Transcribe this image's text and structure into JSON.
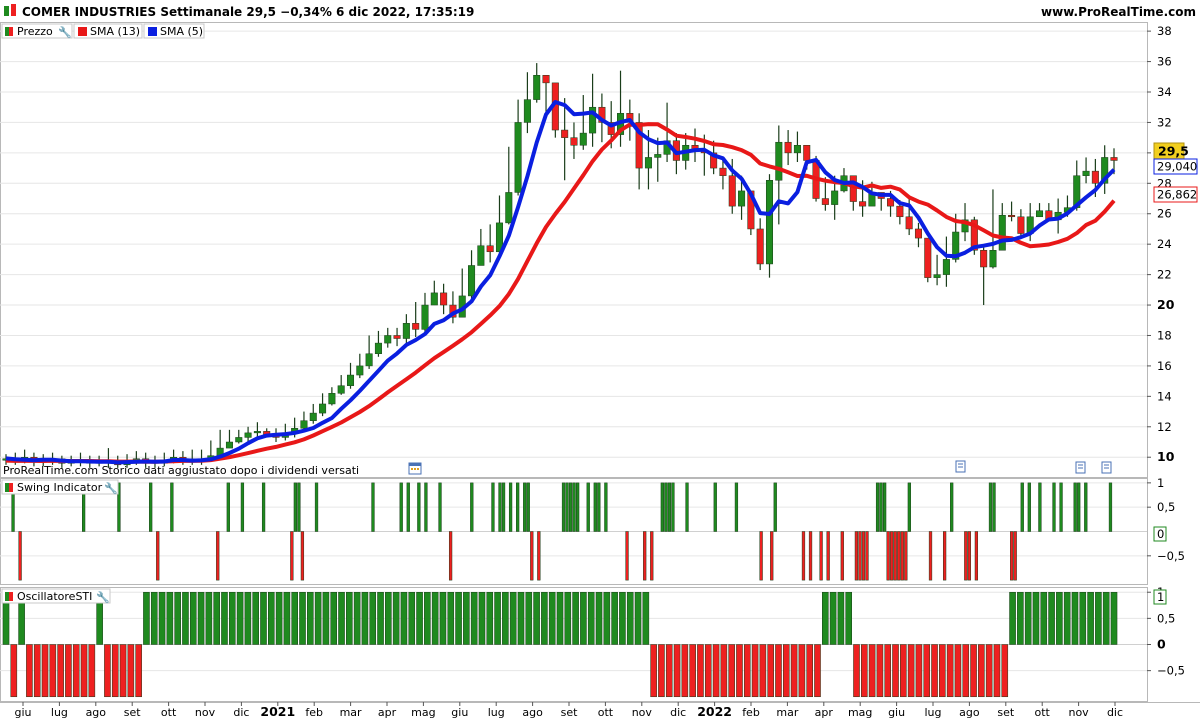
{
  "header": {
    "title": "COMER INDUSTRIES Settimanale 29,5 −0,34% 6 dic 2022, 17:35:19",
    "site": "www.ProRealTime.com"
  },
  "legend": {
    "price_label": "Prezzo",
    "sma13_label": "SMA (13)",
    "sma5_label": "SMA (5)"
  },
  "footer_note": "ProRealTime.com  Storico dati aggiustato dopo i dividendi versati",
  "badges": {
    "last_price": "29,5",
    "sma5_value": "29,040",
    "sma13_value": "26,862",
    "swing_last": "0",
    "sti_last": "1"
  },
  "panels": {
    "swing_title": "Swing Indicator",
    "sti_title": "OscillatoreSTI"
  },
  "colors": {
    "up": "#1f8a1f",
    "down": "#ee2020",
    "sma5": "#0a1fe0",
    "sma13": "#e81818",
    "grid": "#e6e6e6",
    "last_badge": "#f2cf1f"
  },
  "chart_data": [
    {
      "type": "candlestick",
      "title": "COMER INDUSTRIES Settimanale",
      "x_ticks": [
        "giu",
        "lug",
        "ago",
        "set",
        "ott",
        "nov",
        "dic",
        "2021",
        "feb",
        "mar",
        "apr",
        "mag",
        "giu",
        "lug",
        "ago",
        "set",
        "ott",
        "nov",
        "dic",
        "2022",
        "feb",
        "mar",
        "apr",
        "mag",
        "giu",
        "lug",
        "ago",
        "set",
        "ott",
        "nov",
        "dic"
      ],
      "y_ticks": [
        10,
        12,
        14,
        16,
        18,
        20,
        22,
        24,
        26,
        28,
        30,
        32,
        34,
        36,
        38
      ],
      "ylim": [
        8.7,
        38.6
      ],
      "close": [
        9.9,
        9.8,
        10.0,
        9.7,
        9.8,
        9.9,
        9.6,
        9.7,
        9.8,
        9.6,
        9.7,
        9.7,
        9.5,
        9.7,
        9.9,
        9.8,
        9.6,
        9.8,
        10.0,
        9.9,
        9.7,
        9.9,
        10.1,
        10.6,
        11.0,
        11.3,
        11.6,
        11.7,
        11.5,
        11.3,
        11.6,
        11.9,
        12.4,
        12.9,
        13.5,
        14.2,
        14.7,
        15.4,
        16.0,
        16.8,
        17.5,
        18.0,
        17.8,
        18.8,
        18.4,
        20.0,
        20.8,
        20.0,
        19.2,
        20.6,
        22.6,
        23.9,
        23.5,
        25.4,
        27.4,
        32.0,
        33.5,
        35.1,
        34.6,
        31.5,
        31.0,
        30.5,
        31.3,
        33.0,
        32.0,
        31.2,
        32.6,
        32.0,
        29.0,
        29.7,
        29.9,
        30.8,
        29.5,
        30.5,
        30.2,
        30.0,
        29.0,
        28.5,
        26.5,
        27.5,
        25.0,
        22.7,
        28.2,
        30.7,
        30.0,
        30.5,
        29.5,
        27.0,
        26.6,
        27.5,
        28.5,
        26.8,
        26.5,
        27.4,
        27.0,
        26.5,
        25.8,
        25.0,
        24.4,
        21.8,
        22.0,
        23.0,
        24.8,
        25.6,
        23.6,
        22.5,
        23.6,
        25.9,
        25.8,
        24.7,
        25.8,
        26.2,
        25.6,
        26.1,
        26.4,
        28.5,
        28.8,
        28.0,
        29.7,
        29.5
      ],
      "high": [
        10.2,
        10.3,
        10.5,
        10.3,
        10.2,
        10.3,
        10.1,
        10.1,
        10.3,
        10.1,
        10.1,
        10.6,
        10.1,
        10.2,
        10.4,
        10.3,
        10.1,
        10.3,
        10.5,
        10.4,
        10.5,
        10.5,
        11.1,
        11.8,
        11.8,
        11.8,
        12.0,
        12.3,
        11.9,
        11.9,
        12.2,
        12.6,
        13.0,
        13.5,
        14.2,
        14.6,
        15.4,
        16.2,
        16.8,
        18.0,
        18.3,
        18.5,
        18.5,
        19.4,
        20.2,
        20.8,
        21.6,
        21.4,
        20.9,
        22.4,
        23.6,
        25.0,
        25.3,
        27.2,
        30.4,
        33.5,
        35.3,
        35.9,
        34.6,
        34.0,
        33.6,
        32.0,
        33.8,
        35.2,
        33.9,
        33.4,
        35.4,
        33.5,
        32.6,
        31.5,
        31.0,
        33.3,
        31.3,
        31.3,
        31.6,
        31.2,
        30.8,
        29.5,
        29.6,
        28.5,
        27.5,
        25.7,
        28.6,
        31.8,
        31.5,
        31.4,
        30.4,
        29.8,
        28.4,
        28.5,
        29.0,
        28.1,
        28.2,
        28.1,
        27.4,
        27.5,
        26.9,
        27.2,
        25.4,
        23.8,
        23.3,
        24.5,
        26.0,
        26.7,
        25.8,
        23.9,
        27.6,
        26.7,
        26.8,
        26.3,
        26.7,
        26.7,
        26.7,
        27.0,
        27.2,
        29.5,
        29.7,
        29.6,
        30.5,
        30.3
      ],
      "low": [
        9.5,
        9.5,
        9.6,
        9.4,
        9.4,
        9.5,
        9.3,
        9.4,
        9.4,
        9.3,
        9.4,
        9.3,
        9.3,
        9.3,
        9.5,
        9.3,
        9.3,
        9.4,
        9.6,
        9.5,
        9.5,
        9.5,
        9.7,
        10.0,
        10.6,
        10.9,
        10.9,
        11.2,
        11.3,
        11.0,
        11.1,
        11.3,
        11.8,
        12.2,
        12.7,
        13.4,
        14.1,
        14.5,
        15.2,
        15.8,
        16.6,
        17.2,
        17.3,
        17.5,
        17.9,
        18.2,
        20.0,
        19.4,
        18.8,
        19.2,
        20.4,
        22.6,
        22.8,
        23.4,
        25.3,
        27.2,
        31.3,
        33.3,
        32.5,
        31.0,
        28.2,
        29.6,
        30.2,
        30.4,
        30.7,
        30.3,
        30.4,
        30.8,
        27.6,
        27.6,
        28.1,
        29.4,
        28.6,
        28.9,
        29.4,
        28.5,
        28.6,
        27.6,
        26.0,
        25.6,
        24.6,
        22.3,
        21.8,
        25.3,
        29.2,
        29.4,
        28.9,
        26.8,
        26.2,
        25.6,
        27.4,
        26.2,
        25.8,
        26.6,
        26.2,
        25.8,
        25.3,
        24.6,
        23.8,
        21.5,
        21.3,
        21.2,
        22.8,
        24.2,
        23.3,
        20.0,
        22.4,
        24.5,
        25.5,
        24.4,
        24.2,
        25.8,
        25.5,
        24.7,
        25.8,
        26.2,
        28.0,
        27.1,
        27.3,
        28.6
      ],
      "sma5": [
        9.92,
        9.86,
        9.84,
        9.8,
        9.84,
        9.84,
        9.78,
        9.74,
        9.74,
        9.72,
        9.7,
        9.7,
        9.66,
        9.68,
        9.7,
        9.72,
        9.7,
        9.72,
        9.82,
        9.82,
        9.78,
        9.8,
        9.86,
        10.04,
        10.28,
        10.56,
        10.92,
        11.24,
        11.42,
        11.48,
        11.52,
        11.6,
        11.74,
        11.92,
        12.26,
        12.58,
        13.18,
        13.74,
        14.36,
        15.02,
        15.68,
        16.34,
        16.82,
        17.38,
        17.7,
        18.1,
        18.76,
        19.0,
        19.44,
        19.72,
        20.24,
        21.22,
        21.96,
        23.2,
        24.56,
        26.44,
        28.46,
        30.68,
        32.52,
        33.34,
        33.14,
        32.54,
        32.58,
        32.66,
        32.16,
        31.8,
        32.02,
        32.16,
        31.36,
        30.9,
        30.64,
        30.68,
        29.98,
        30.08,
        30.18,
        30.2,
        29.84,
        29.64,
        28.84,
        28.3,
        27.3,
        26.04,
        25.98,
        26.82,
        26.68,
        27.42,
        29.38,
        29.54,
        28.72,
        28.22,
        28.02,
        28.06,
        27.76,
        27.34,
        27.24,
        27.24,
        26.7,
        26.54,
        25.74,
        24.7,
        23.8,
        23.24,
        23.2,
        23.44,
        23.8,
        23.9,
        24.02,
        24.24,
        24.28,
        24.46,
        24.7,
        25.22,
        25.62,
        25.68,
        26.02,
        26.56,
        27.08,
        27.56,
        28.28,
        28.9
      ],
      "sma13": [
        9.78,
        9.76,
        9.77,
        9.76,
        9.75,
        9.77,
        9.76,
        9.75,
        9.75,
        9.75,
        9.74,
        9.74,
        9.71,
        9.71,
        9.72,
        9.7,
        9.7,
        9.72,
        9.74,
        9.76,
        9.76,
        9.77,
        9.81,
        9.9,
        10.0,
        10.13,
        10.27,
        10.42,
        10.56,
        10.68,
        10.83,
        10.98,
        11.17,
        11.43,
        11.71,
        11.99,
        12.28,
        12.62,
        12.97,
        13.36,
        13.8,
        14.26,
        14.69,
        15.13,
        15.56,
        16.04,
        16.51,
        16.91,
        17.32,
        17.75,
        18.21,
        18.76,
        19.32,
        19.93,
        20.72,
        21.72,
        22.89,
        24.06,
        25.13,
        25.98,
        26.78,
        27.66,
        28.53,
        29.45,
        30.22,
        30.81,
        31.48,
        31.86,
        31.83,
        31.89,
        31.88,
        31.53,
        31.13,
        31.04,
        30.93,
        30.78,
        30.57,
        30.52,
        30.37,
        30.18,
        29.87,
        29.3,
        29.11,
        28.95,
        28.72,
        28.48,
        28.49,
        28.31,
        28.17,
        28.07,
        28.02,
        27.8,
        27.71,
        27.86,
        27.7,
        27.78,
        27.59,
        27.08,
        26.8,
        26.6,
        26.21,
        25.79,
        25.52,
        25.44,
        25.25,
        24.92,
        24.57,
        24.44,
        24.39,
        24.09,
        23.86,
        23.91,
        23.98,
        24.14,
        24.35,
        24.73,
        25.26,
        25.54,
        26.14,
        26.86
      ],
      "series": [
        {
          "name": "Prezzo"
        },
        {
          "name": "SMA (13)"
        },
        {
          "name": "SMA (5)"
        }
      ]
    },
    {
      "type": "bar",
      "title": "Swing Indicator",
      "y_ticks": [
        1,
        0.5,
        -0.5
      ],
      "ylim": [
        -1.1,
        1.1
      ],
      "values": [
        0,
        0,
        1,
        0,
        -1,
        0,
        0,
        0,
        0,
        0,
        0,
        0,
        0,
        0,
        0,
        0,
        0,
        0,
        0,
        0,
        0,
        0,
        1,
        0,
        0,
        0,
        0,
        0,
        0,
        0,
        0,
        0,
        1,
        0,
        0,
        0,
        0,
        0,
        0,
        0,
        0,
        1,
        0,
        -1,
        0,
        0,
        0,
        1,
        0,
        0,
        0,
        0,
        0,
        0,
        0,
        0,
        0,
        0,
        0,
        0,
        -1,
        0,
        0,
        1,
        0,
        0,
        0,
        1,
        0,
        0,
        0,
        0,
        0,
        1,
        0,
        0,
        0,
        0,
        0,
        0,
        0,
        -1,
        1,
        1,
        -1,
        0,
        0,
        0,
        1,
        0,
        0,
        0,
        0,
        0,
        0,
        0,
        0,
        0,
        0,
        0,
        0,
        0,
        0,
        0,
        1,
        0,
        0,
        0,
        0,
        0,
        0,
        0,
        1,
        0,
        1,
        0,
        0,
        1,
        0,
        1,
        0,
        0,
        0,
        1,
        0,
        0,
        -1,
        0,
        0,
        0,
        0,
        0,
        1,
        0,
        0,
        0,
        0,
        0,
        1,
        0,
        1,
        1,
        0,
        1,
        0,
        1,
        0,
        1,
        1,
        -1,
        0,
        -1,
        0,
        0,
        0,
        0,
        0,
        0,
        1,
        1,
        1,
        1,
        1,
        0,
        0,
        1,
        0,
        1,
        1,
        0,
        1,
        0,
        0,
        0,
        0,
        0,
        -1,
        0,
        0,
        0,
        0,
        -1,
        0,
        -1,
        0,
        0,
        1,
        1,
        1,
        1,
        0,
        0,
        0,
        1,
        0,
        0,
        0,
        0,
        0,
        0,
        0,
        1,
        0,
        0,
        0,
        0,
        0,
        1,
        0,
        0,
        0,
        0,
        0,
        0,
        -1,
        0,
        0,
        -1,
        1,
        0,
        0,
        0,
        0,
        0,
        0,
        0,
        -1,
        0,
        -1,
        0,
        0,
        -1,
        0,
        -1,
        0,
        0,
        0,
        -1,
        0,
        0,
        0,
        -1,
        -1,
        -1,
        -1,
        0,
        0,
        1,
        1,
        1,
        -1,
        -1,
        -1,
        -1,
        -1,
        -1,
        1,
        0,
        0,
        0,
        0,
        0,
        -1,
        0,
        0,
        0,
        -1,
        0,
        1,
        0,
        0,
        0,
        -1,
        -1,
        0,
        -1,
        0,
        0,
        0,
        1,
        1,
        0,
        0,
        0,
        0,
        -1,
        -1,
        0,
        1,
        0,
        1,
        0,
        0,
        1,
        0,
        0,
        0,
        1,
        0,
        1,
        0,
        0,
        0,
        1,
        1,
        0,
        1,
        0,
        0,
        0,
        0,
        0,
        0,
        1,
        0
      ]
    },
    {
      "type": "bar",
      "title": "OscillatoreSTI",
      "y_ticks": [
        1,
        0.5,
        0,
        -0.5
      ],
      "ylim": [
        -1.1,
        1.1
      ],
      "values": [
        1,
        -1,
        1,
        -1,
        -1,
        -1,
        -1,
        -1,
        -1,
        -1,
        -1,
        -1,
        1,
        -1,
        -1,
        -1,
        -1,
        -1,
        1,
        1,
        1,
        1,
        1,
        1,
        1,
        1,
        1,
        1,
        1,
        1,
        1,
        1,
        1,
        1,
        1,
        1,
        1,
        1,
        1,
        1,
        1,
        1,
        1,
        1,
        1,
        1,
        1,
        1,
        1,
        1,
        1,
        1,
        1,
        1,
        1,
        1,
        1,
        1,
        1,
        1,
        1,
        1,
        1,
        1,
        1,
        1,
        1,
        1,
        1,
        1,
        1,
        1,
        1,
        1,
        1,
        1,
        1,
        1,
        1,
        1,
        1,
        1,
        1,
        -1,
        -1,
        -1,
        -1,
        -1,
        -1,
        -1,
        -1,
        -1,
        -1,
        -1,
        -1,
        -1,
        -1,
        -1,
        -1,
        -1,
        -1,
        -1,
        -1,
        -1,
        -1,
        1,
        1,
        1,
        1,
        -1,
        -1,
        -1,
        -1,
        -1,
        -1,
        -1,
        -1,
        -1,
        -1,
        -1,
        -1,
        -1,
        -1,
        -1,
        -1,
        -1,
        -1,
        -1,
        -1,
        1,
        1,
        1,
        1,
        1,
        1,
        1,
        1,
        1,
        1,
        1,
        1,
        1,
        1
      ]
    }
  ]
}
